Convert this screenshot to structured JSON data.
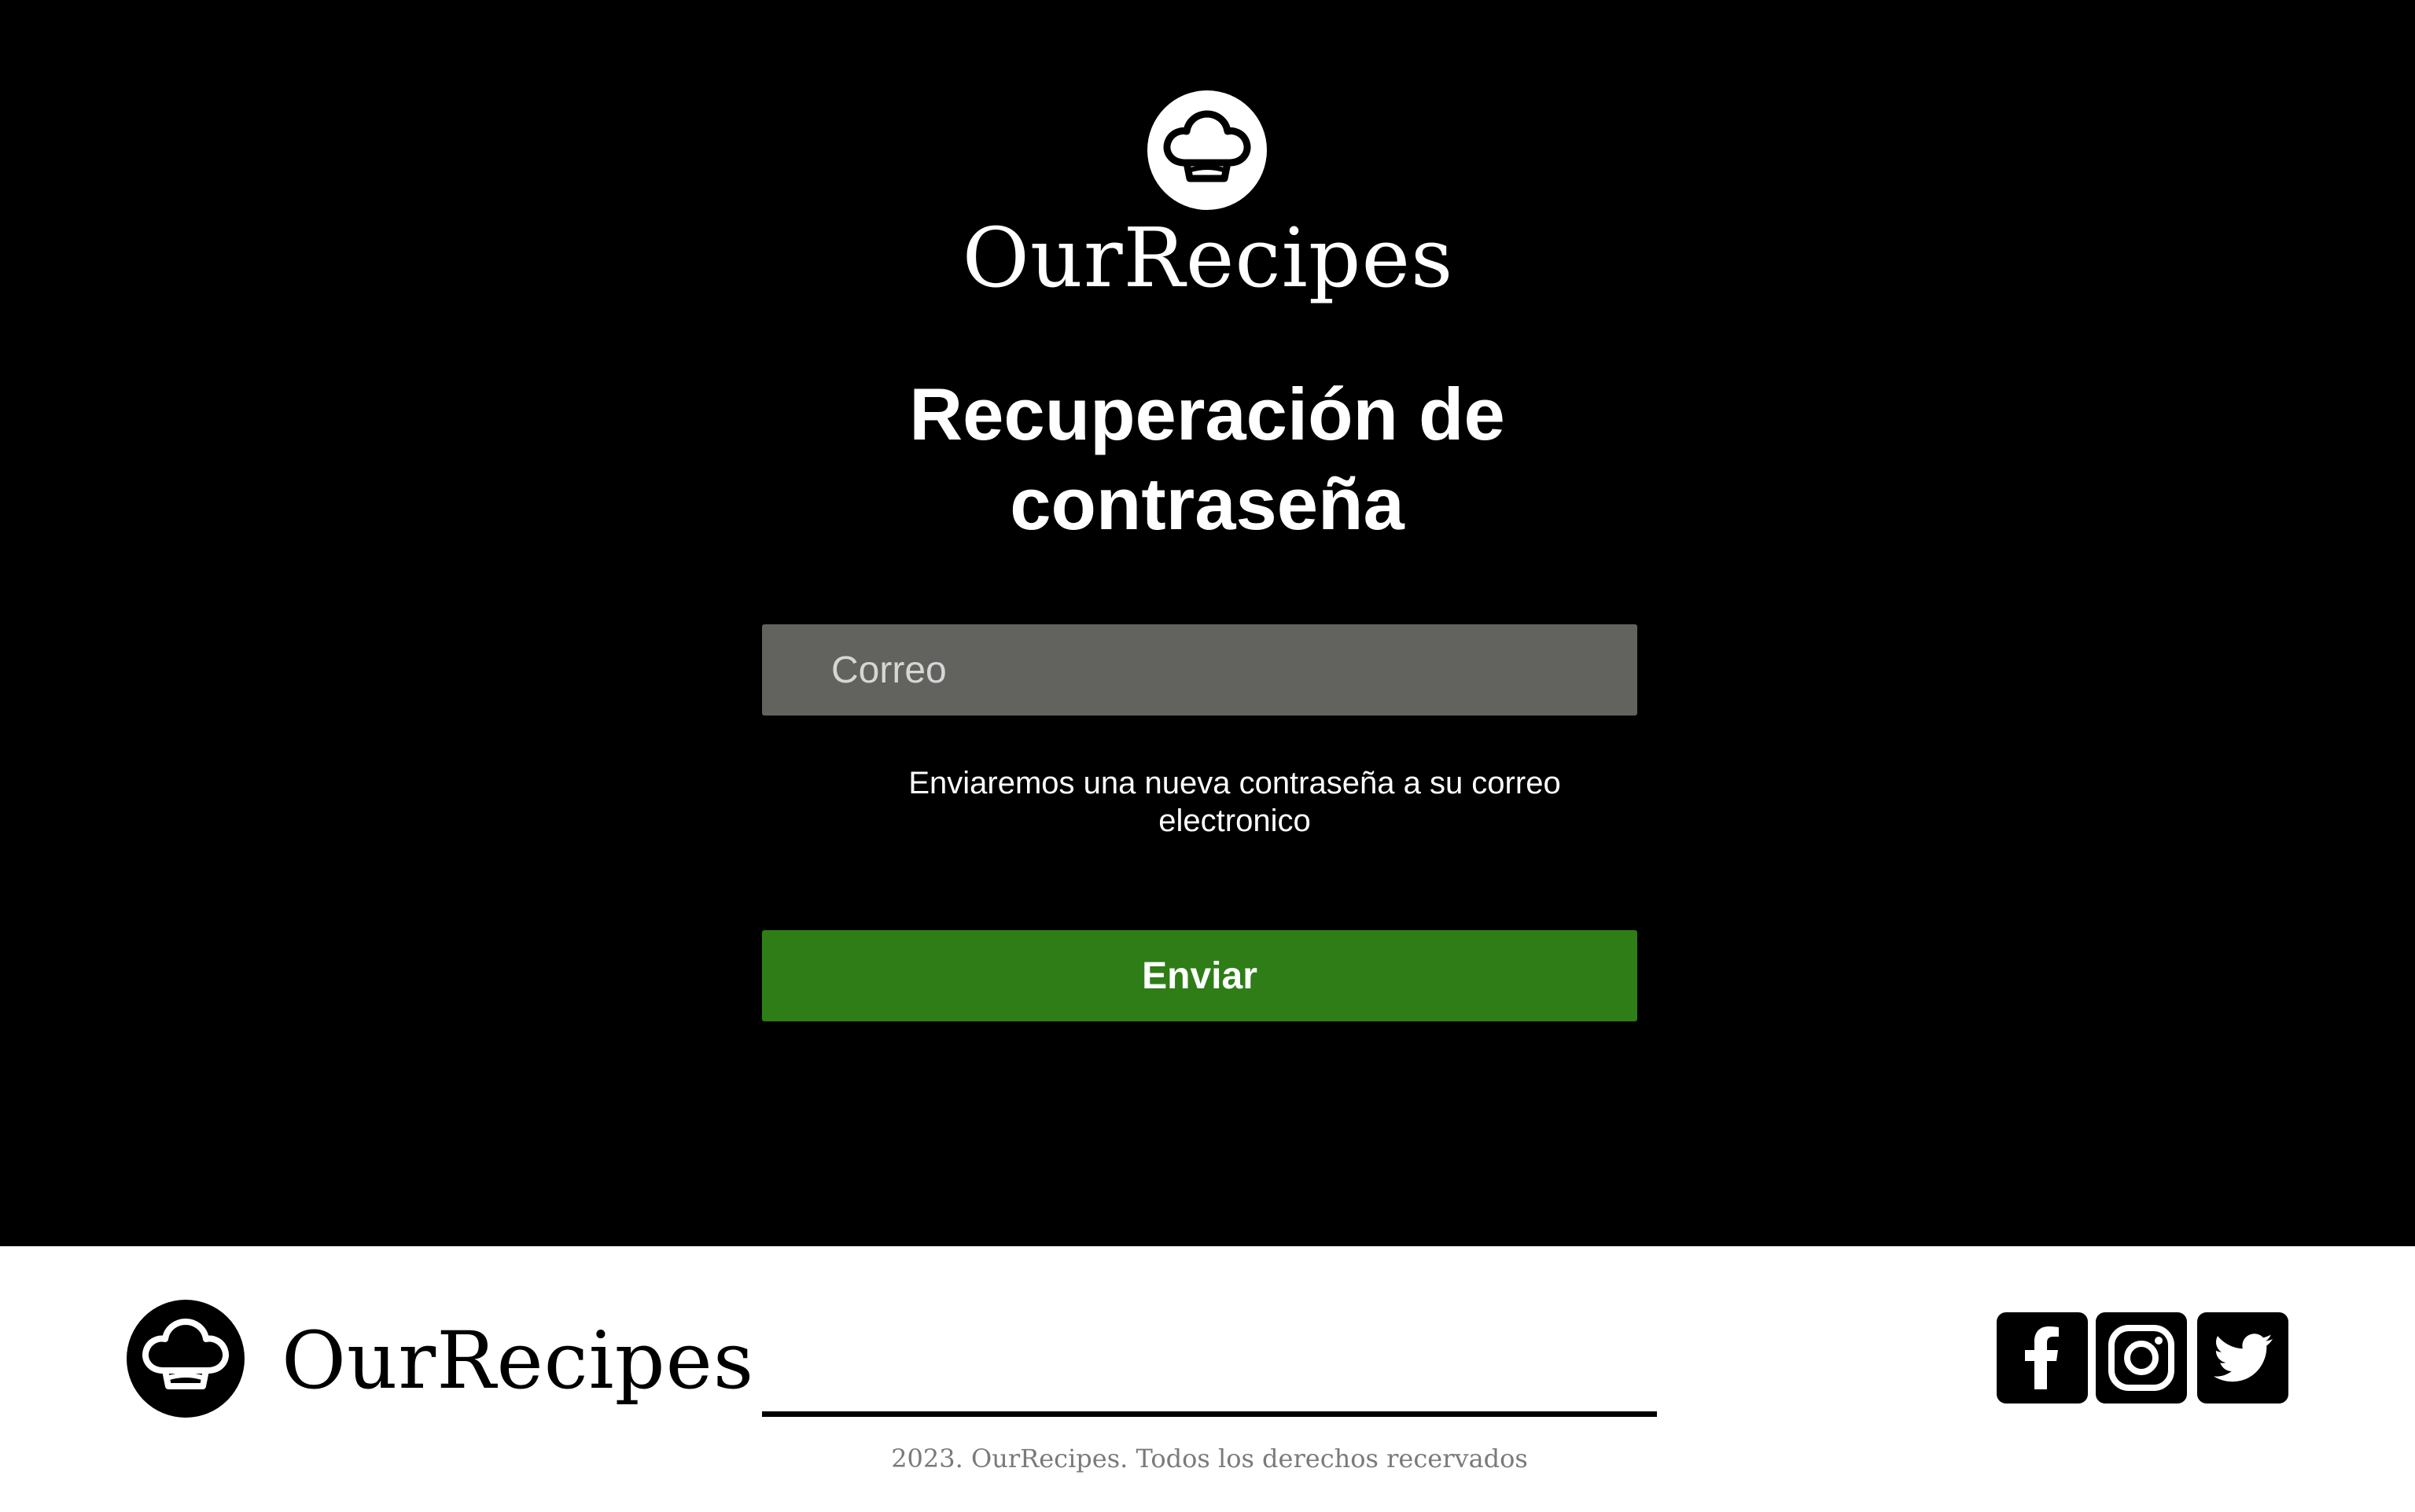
{
  "app": {
    "brand_name": "OurRecipes",
    "logo_icon": "chef-hat-icon"
  },
  "main": {
    "title": "Recuperación de contraseña",
    "email_input": {
      "placeholder": "Correo",
      "value": ""
    },
    "hint": "Enviaremos una nueva contraseña a su correo electronico",
    "submit_label": "Enviar"
  },
  "footer": {
    "brand_name": "OurRecipes",
    "copyright": "2023. OurRecipes. Todos los derechos recervados",
    "social": [
      {
        "name": "facebook",
        "icon": "facebook-icon"
      },
      {
        "name": "instagram",
        "icon": "instagram-icon"
      },
      {
        "name": "twitter",
        "icon": "twitter-icon"
      }
    ]
  },
  "colors": {
    "background": "#000000",
    "footer_background": "#ffffff",
    "input_background": "#62625e",
    "button_background": "#2e7d17",
    "text_primary": "#ffffff",
    "copyright_text": "#7a7a7a"
  }
}
